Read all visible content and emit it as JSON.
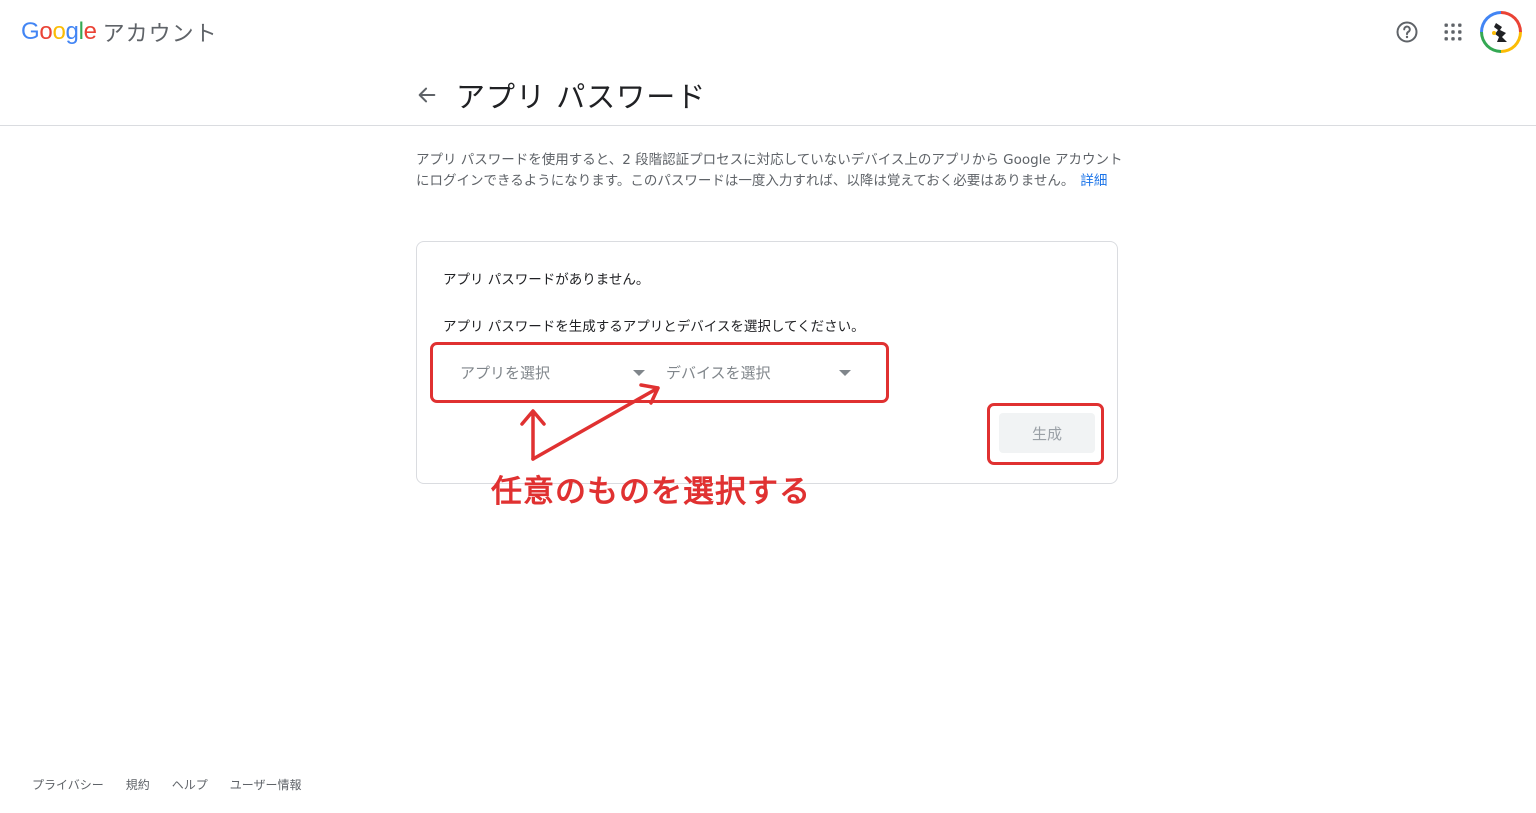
{
  "header": {
    "logo_text": "Google",
    "logo_suffix": "アカウント",
    "icons": [
      "help-icon",
      "apps-icon",
      "avatar"
    ]
  },
  "page": {
    "title": "アプリ パスワード",
    "description": "アプリ パスワードを使用すると、2 段階認証プロセスに対応していないデバイス上のアプリから Google アカウントにログインできるようになります。このパスワードは一度入力すれば、以降は覚えておく必要はありません。",
    "learn_more": "詳細"
  },
  "card": {
    "no_passwords": "アプリ パスワードがありません。",
    "instruction": "アプリ パスワードを生成するアプリとデバイスを選択してください。",
    "select_app": "アプリを選択",
    "select_device": "デバイスを選択",
    "generate_button": "生成"
  },
  "annotation": {
    "text": "任意のものを選択する",
    "color": "#e03131"
  },
  "footer": {
    "links": [
      "プライバシー",
      "規約",
      "ヘルプ",
      "ユーザー情報"
    ]
  },
  "colors": {
    "google_blue": "#4285f4",
    "google_red": "#ea4335",
    "google_yellow": "#fbbc05",
    "google_green": "#34a853",
    "link": "#1a73e8"
  }
}
